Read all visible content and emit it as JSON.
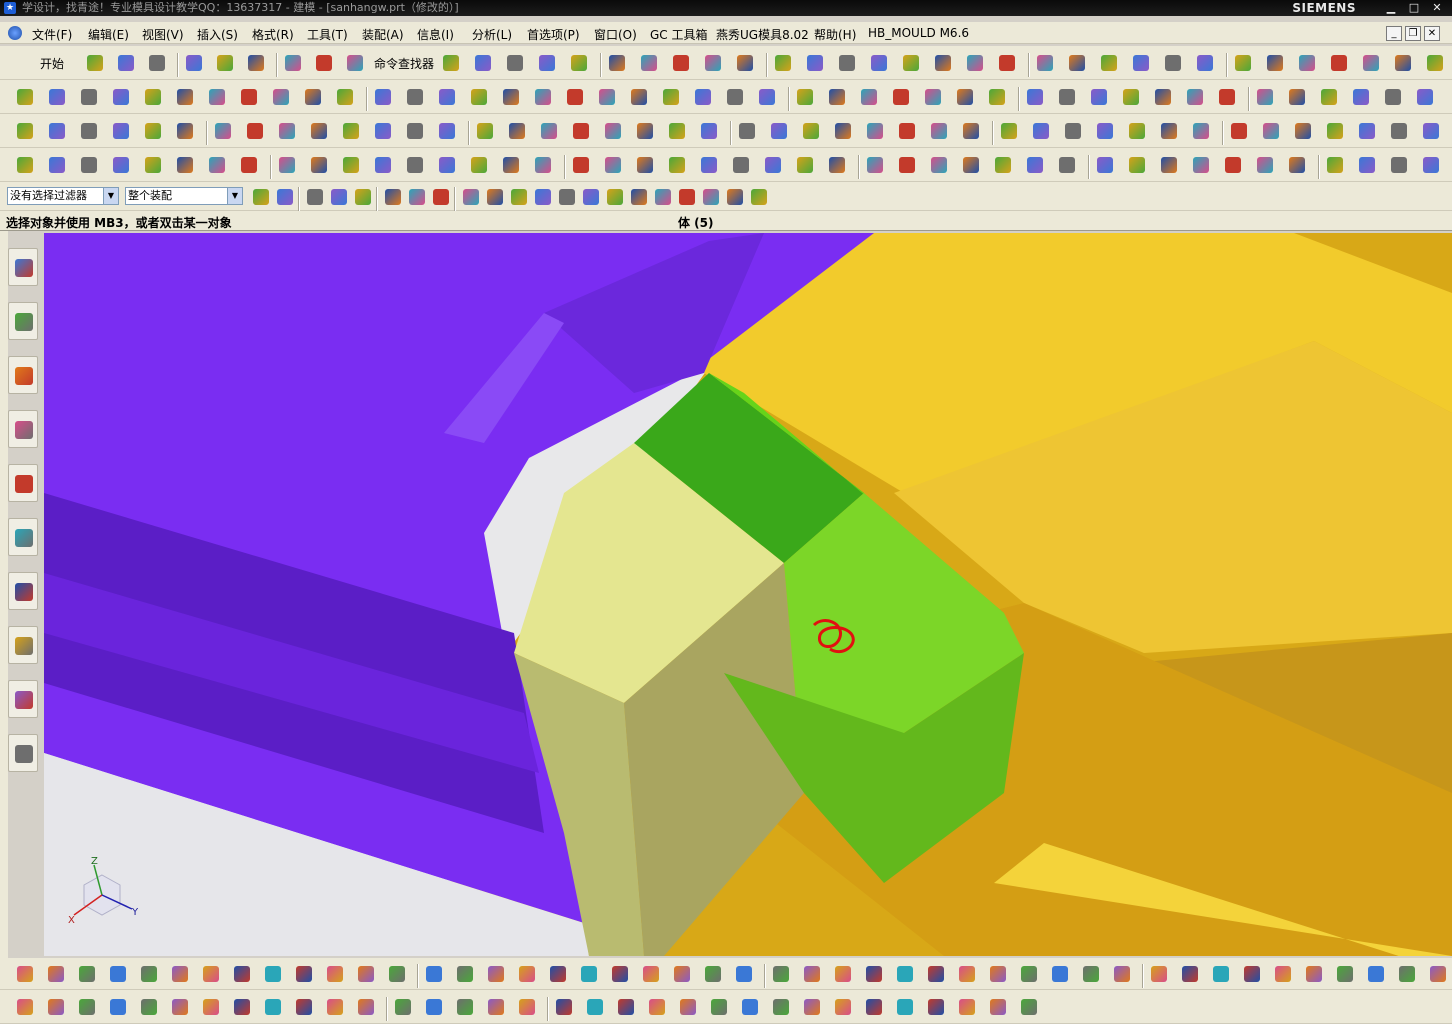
{
  "window": {
    "title": "学设计，找青途！专业模具设计教学QQ：13637317 - 建模 - [sanhangw.prt（修改的）]",
    "brand": "SIEMENS"
  },
  "menu": [
    "文件(F)",
    "编辑(E)",
    "视图(V)",
    "插入(S)",
    "格式(R)",
    "工具(T)",
    "装配(A)",
    "信息(I)",
    "分析(L)",
    "首选项(P)",
    "窗口(O)",
    "GC 工具箱",
    "燕秀UG模具8.02",
    "帮助(H)",
    "HB_MOULD M6.6"
  ],
  "toolbar": {
    "start_label": "开始",
    "cmd_finder_label": "命令查找器"
  },
  "selection_bar": {
    "filter_value": "没有选择过滤器",
    "scope_value": "整个装配"
  },
  "status": {
    "prompt": "选择对象并使用 MB3，或者双击某一对象",
    "selection_info": "体 (5)"
  },
  "triad": {
    "x": "X",
    "y": "Y",
    "z": "Z"
  },
  "colors": {
    "purple_body": "#7b2ff0",
    "yellow_body": "#e6b41e",
    "green_body": "#58c80a",
    "pale_body": "#e4e690"
  }
}
